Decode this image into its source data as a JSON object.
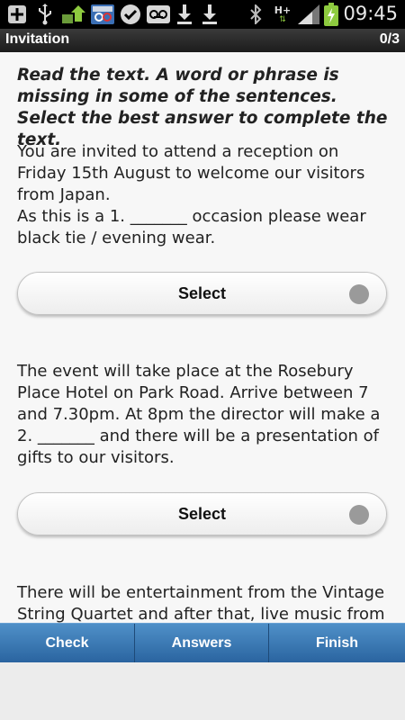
{
  "status_bar": {
    "time": "09:45",
    "network_label": "H+",
    "icons": [
      "add-icon",
      "usb-icon",
      "upload-icon",
      "app-icon",
      "check-icon",
      "voicemail-icon",
      "download-icon",
      "download-icon",
      "bluetooth-icon",
      "signal-icon",
      "battery-charging-icon"
    ]
  },
  "app_bar": {
    "title": "Invitation",
    "counter": "0/3"
  },
  "content": {
    "instructions": "Read the text. A word or phrase is missing in some of the sentences. Select the best answer to complete the text.",
    "paragraph_1": "You are invited to attend a reception on Friday 15th August to welcome our visitors from Japan.\nAs this is a 1. _______ occasion please wear black tie / evening wear.",
    "select_1": "Select",
    "paragraph_2": "The event will take place at the Rosebury Place Hotel on Park Road. Arrive between 7 and 7.30pm. At 8pm the director will make a 2. _______ and there will be a presentation of gifts to our visitors.",
    "select_2": "Select",
    "paragraph_3": "There will be entertainment from the Vintage String Quartet and after that, live music from"
  },
  "bottom_bar": {
    "check": "Check",
    "answers": "Answers",
    "finish": "Finish"
  },
  "colors": {
    "tab_bar": "#3a78b4",
    "app_bar": "#2a2a2a",
    "background": "#f7f7f7"
  }
}
